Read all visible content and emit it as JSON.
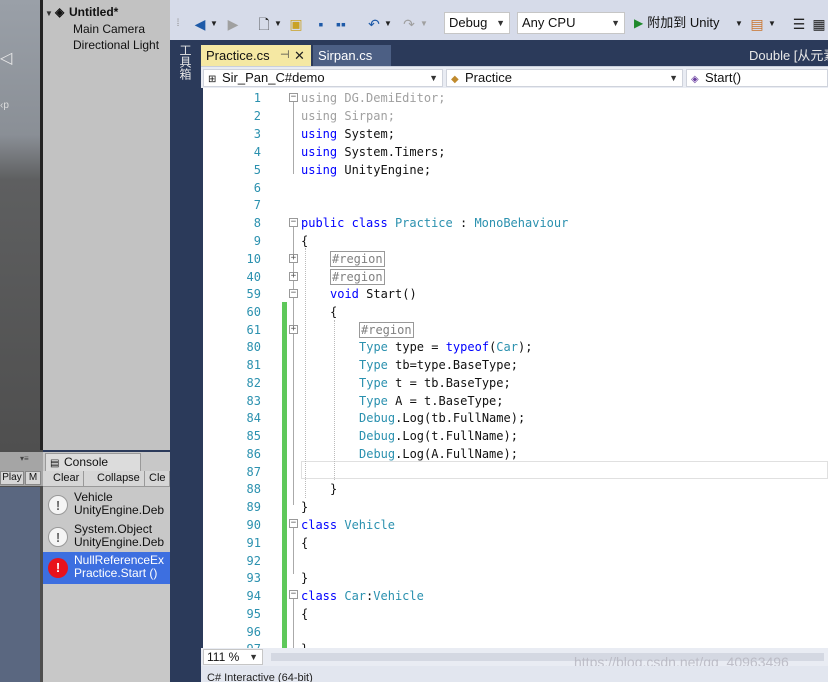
{
  "unity": {
    "hierarchy": {
      "scene_name": "Untitled*",
      "items": [
        "Main Camera",
        "Directional Light"
      ]
    },
    "game_toolbar": {
      "play_label": "Play",
      "maximize_label": "M"
    },
    "console": {
      "tab_label": "Console",
      "toolbar": {
        "clear": "Clear",
        "collapse": "Collapse",
        "clear_on_play": "Cle"
      },
      "entries": [
        {
          "line1": "Vehicle",
          "line2": "UnityEngine.Deb",
          "level": "info"
        },
        {
          "line1": "System.Object",
          "line2": "UnityEngine.Deb",
          "level": "info"
        },
        {
          "line1": "NullReferenceEx",
          "line2": "Practice.Start ()",
          "level": "error",
          "selected": true
        }
      ]
    }
  },
  "vs": {
    "toolbar": {
      "config": "Debug",
      "platform": "Any CPU",
      "attach_label": "附加到 Unity"
    },
    "toolbox_label": "工具箱",
    "tabs": {
      "active": "Practice.cs",
      "other": "Sirpan.cs",
      "right_text": "Double [从元素"
    },
    "nav": {
      "project": "Sir_Pan_C#demo",
      "class": "Practice",
      "member": "Start()"
    },
    "zoom": "111 %",
    "bottom_panel_label": "C# Interactive (64-bit)",
    "watermark": "https://blog.csdn.net/qq_40963496",
    "line_numbers": [
      "1",
      "2",
      "3",
      "4",
      "5",
      "6",
      "7",
      "8",
      "9",
      "10",
      "40",
      "59",
      "60",
      "61",
      "80",
      "81",
      "82",
      "83",
      "84",
      "85",
      "86",
      "87",
      "88",
      "89",
      "90",
      "91",
      "92",
      "93",
      "94",
      "95",
      "96",
      "97"
    ],
    "code": {
      "l1_kw": "using",
      "l1_rest": " DG.DemiEditor;",
      "l2_kw": "using",
      "l2_rest": " Sirpan;",
      "l3_kw": "using",
      "l3_rest": " System;",
      "l4_kw": "using",
      "l4_rest": " System.Timers;",
      "l5_kw": "using",
      "l5_rest": " UnityEngine;",
      "l8_kw1": "public",
      "l8_kw2": "class",
      "l8_name": "Practice",
      "l8_colon": " : ",
      "l8_base": "MonoBehaviour",
      "brace_open": "{",
      "brace_close": "}",
      "region": "#region",
      "l59_kw": "void",
      "l59_rest": " Start()",
      "l80_type": "Type",
      "l80_mid": " type = ",
      "l80_kw": "typeof",
      "l80_p1": "(",
      "l80_car": "Car",
      "l80_p2": ");",
      "l81_type": "Type",
      "l81_rest": " tb=type.BaseType;",
      "l82_type": "Type",
      "l82_rest": " t = tb.BaseType;",
      "l83_type": "Type",
      "l83_rest": " A = t.BaseType;",
      "debug": "Debug",
      "l84_rest": ".Log(tb.FullName);",
      "l85_rest": ".Log(t.FullName);",
      "l86_rest": ".Log(A.FullName);",
      "class_kw": "class",
      "l90_name": "Vehicle",
      "l94_name": "Car",
      "l94_colon": ":",
      "l94_base": "Vehicle"
    }
  }
}
